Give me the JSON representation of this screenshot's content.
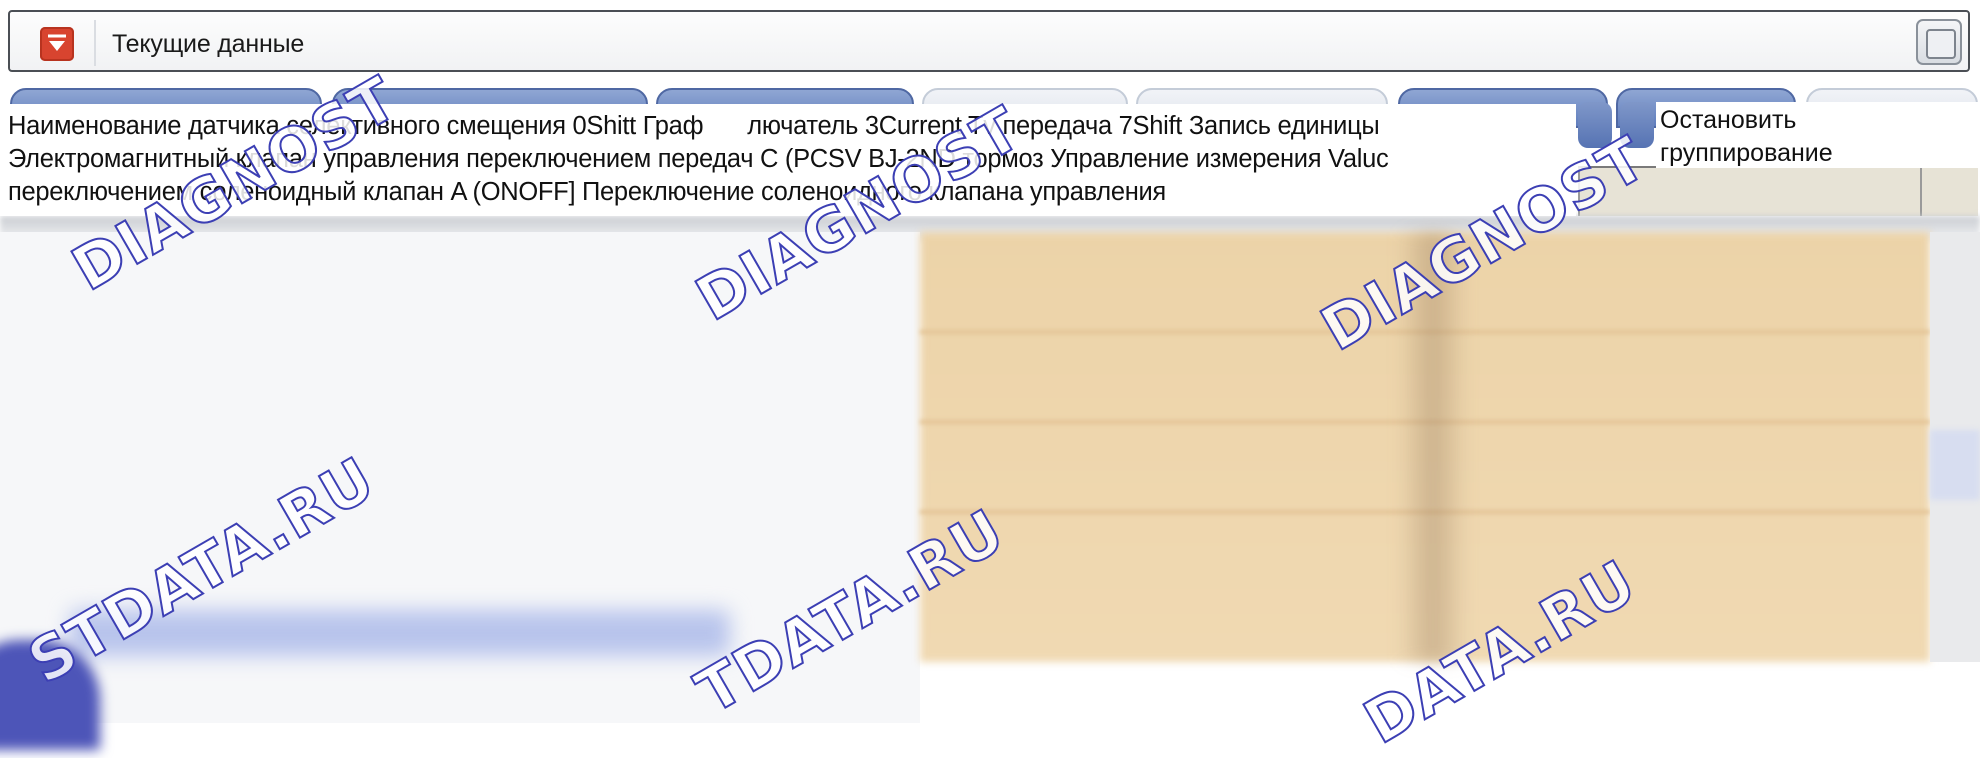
{
  "window": {
    "title": "Текущие данные",
    "app_icon": "dropdown-arrow-icon",
    "maximize_icon": "window-restore-icon"
  },
  "content_text": {
    "line1_a": "Наименование датчика селективного смещения 0Shitt Граф",
    "line1_b": "лючатель 3Current Tv передача 7Shift  Запись единицы",
    "line2": "Электромагнитный клапан управления переключением передач С (PCSV BJ-2ND тормоз Управление измерения Valuc",
    "line3": "переключением соленоидный клапан A (ONOFF] Переключение соленоидного клапана управления"
  },
  "stop_button": {
    "line1": "Остановить",
    "line2": "группирование"
  },
  "watermarks": {
    "diagnost": "DIAGNOST",
    "data_ru": "STDATA.RU",
    "data_ru_2": "TDATA.RU",
    "data_ru_3": "DATA.RU"
  },
  "colors": {
    "accent_red": "#d8442f",
    "tab_blue": "#5f7dbd",
    "panel_tan": "#ecd3a8",
    "watermark_stroke": "#3c3fb4"
  }
}
